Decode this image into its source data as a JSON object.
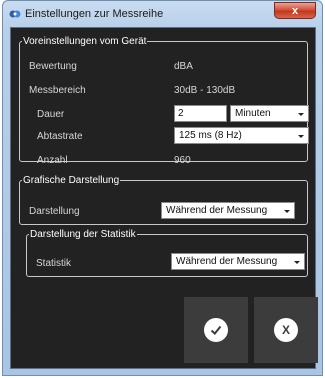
{
  "window": {
    "title": "Einstellungen zur Messreihe",
    "close_label": "x"
  },
  "geraet": {
    "legend": "Voreinstellungen vom Gerät",
    "bewertung_label": "Bewertung",
    "bewertung_value": "dBA",
    "messbereich_label": "Messbereich",
    "messbereich_value": "30dB - 130dB",
    "dauer_label": "Dauer",
    "dauer_value": "2",
    "dauer_unit": "Minuten",
    "abtastrate_label": "Abtastrate",
    "abtastrate_value": "125 ms (8 Hz)",
    "anzahl_label": "Anzahl",
    "anzahl_value": "960"
  },
  "grafik": {
    "legend": "Grafische Darstellung",
    "darstellung_label": "Darstellung",
    "darstellung_value": "Während der Messung"
  },
  "statistik": {
    "legend": "Darstellung der Statistik",
    "statistik_label": "Statistik",
    "statistik_value": "Während der Messung"
  },
  "buttons": {
    "confirm_icon": "checkmark-icon",
    "cancel_icon": "x-icon",
    "cancel_glyph": "X"
  }
}
